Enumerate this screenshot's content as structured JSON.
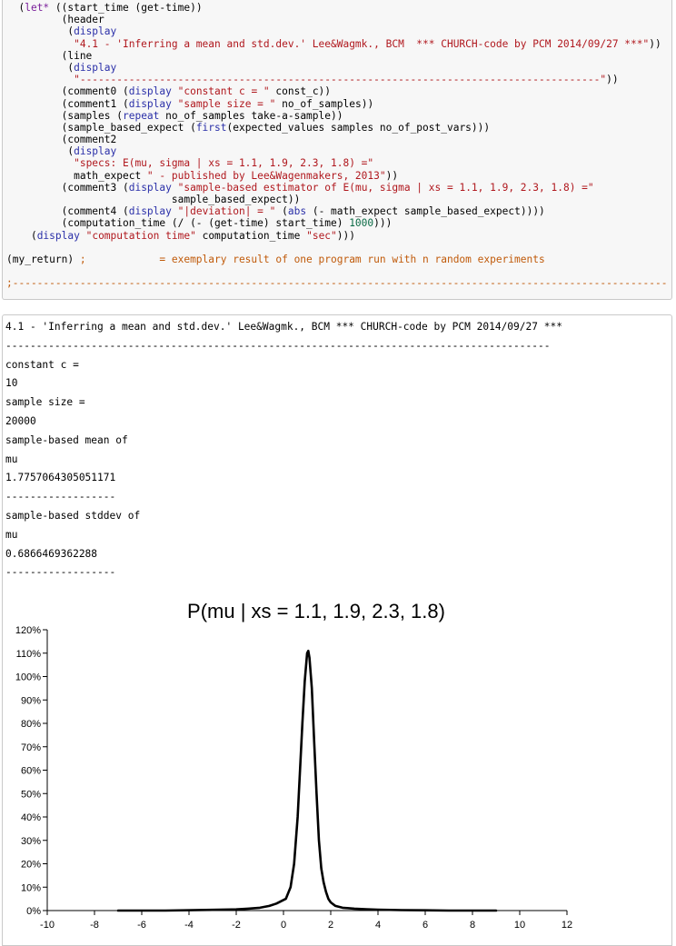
{
  "code": {
    "lines": [
      [
        [
          "",
          "  ("
        ],
        [
          "kw",
          "let*"
        ],
        [
          "",
          " ((start_time (get-time))"
        ]
      ],
      [
        [
          "",
          "         (header"
        ]
      ],
      [
        [
          "",
          "          ("
        ],
        [
          "fn",
          "display"
        ]
      ],
      [
        [
          "",
          "           "
        ],
        [
          "str",
          "\"4.1 - 'Inferring a mean and std.dev.' Lee&Wagmk., BCM  *** CHURCH-code by PCM 2014/09/27 ***\""
        ],
        [
          "",
          "))"
        ]
      ],
      [
        [
          "",
          "         (line"
        ]
      ],
      [
        [
          "",
          "          ("
        ],
        [
          "fn",
          "display"
        ]
      ],
      [
        [
          "",
          "           "
        ],
        [
          "str",
          "\"-------------------------------------------------------------------------------------\""
        ],
        [
          "",
          "))"
        ]
      ],
      [
        [
          "",
          "         (comment0 ("
        ],
        [
          "fn",
          "display"
        ],
        [
          "",
          " "
        ],
        [
          "str",
          "\"constant c = \""
        ],
        [
          "",
          " const_c))"
        ]
      ],
      [
        [
          "",
          "         (comment1 ("
        ],
        [
          "fn",
          "display"
        ],
        [
          "",
          " "
        ],
        [
          "str",
          "\"sample size = \""
        ],
        [
          "",
          " no_of_samples))"
        ]
      ],
      [
        [
          "",
          "         (samples ("
        ],
        [
          "fn",
          "repeat"
        ],
        [
          "",
          " no_of_samples take-a-sample))"
        ]
      ],
      [
        [
          "",
          "         (sample_based_expect ("
        ],
        [
          "fn",
          "first"
        ],
        [
          "",
          "(expected_values samples no_of_post_vars)))"
        ]
      ],
      [
        [
          "",
          "         (comment2"
        ]
      ],
      [
        [
          "",
          "          ("
        ],
        [
          "fn",
          "display"
        ]
      ],
      [
        [
          "",
          "           "
        ],
        [
          "str",
          "\"specs: E(mu, sigma | xs = 1.1, 1.9, 2.3, 1.8) =\""
        ]
      ],
      [
        [
          "",
          "           math_expect "
        ],
        [
          "str",
          "\" - published by Lee&Wagenmakers, 2013\""
        ],
        [
          "",
          "))"
        ]
      ],
      [
        [
          "",
          "         (comment3 ("
        ],
        [
          "fn",
          "display"
        ],
        [
          "",
          " "
        ],
        [
          "str",
          "\"sample-based estimator of E(mu, sigma | xs = 1.1, 1.9, 2.3, 1.8) =\""
        ]
      ],
      [
        [
          "",
          "                           sample_based_expect))"
        ]
      ],
      [
        [
          "",
          "         (comment4 ("
        ],
        [
          "fn",
          "display"
        ],
        [
          "",
          " "
        ],
        [
          "str",
          "\"|deviation| = \""
        ],
        [
          "",
          " ("
        ],
        [
          "fn",
          "abs"
        ],
        [
          "",
          " (- math_expect sample_based_expect))))"
        ]
      ],
      [
        [
          "",
          "         (computation_time (/ (- (get-time) start_time) "
        ],
        [
          "num",
          "1000"
        ],
        [
          "",
          ")))"
        ]
      ],
      [
        [
          "",
          "    ("
        ],
        [
          "fn",
          "display"
        ],
        [
          "",
          " "
        ],
        [
          "str",
          "\"computation time\""
        ],
        [
          "",
          " computation_time "
        ],
        [
          "str",
          "\"sec\""
        ],
        [
          "",
          ")))"
        ]
      ],
      [
        [
          "",
          ""
        ]
      ],
      [
        [
          "",
          "(my_return) "
        ],
        [
          "cmt",
          ";            = exemplary result of one program run with n random experiments"
        ]
      ],
      [
        [
          "",
          ""
        ]
      ],
      [
        [
          "cmt",
          ";-----------------------------------------------------------------------------------------------------------"
        ]
      ]
    ]
  },
  "output": {
    "lines": [
      "4.1 - 'Inferring a mean and std.dev.' Lee&Wagmk., BCM *** CHURCH-code by PCM 2014/09/27 ***",
      "-----------------------------------------------------------------------------------------",
      "constant c =",
      "10",
      "sample size =",
      "20000",
      "sample-based mean of",
      "mu",
      "1.7757064305051171",
      "------------------",
      "sample-based stddev of",
      "mu",
      "0.6866469362288",
      "------------------"
    ]
  },
  "chart_data": {
    "type": "line",
    "title": "P(mu | xs = 1.1, 1.9, 2.3, 1.8)",
    "xlabel": "",
    "ylabel": "",
    "xlim": [
      -10,
      12
    ],
    "ylim": [
      0,
      1.2
    ],
    "x_ticks": [
      -10,
      -8,
      -6,
      -4,
      -2,
      0,
      2,
      4,
      6,
      8,
      10,
      12
    ],
    "y_ticks": [
      0,
      0.1,
      0.2,
      0.3,
      0.4,
      0.5,
      0.6,
      0.7,
      0.8,
      0.9,
      1.0,
      1.1,
      1.2
    ],
    "y_tick_labels": [
      "0%",
      "10%",
      "20%",
      "30%",
      "40%",
      "50%",
      "60%",
      "70%",
      "80%",
      "90%",
      "100%",
      "110%",
      "120%"
    ],
    "grid": false,
    "line_color": "#000000",
    "series": [
      {
        "x": [
          -7.0,
          -5.0,
          -3.0,
          -2.0,
          -1.5,
          -1.0,
          -0.6,
          -0.3,
          -0.1,
          0.1,
          0.3,
          0.45,
          0.6,
          0.7,
          0.8,
          0.9,
          1.0,
          1.05,
          1.1,
          1.2,
          1.3,
          1.4,
          1.5,
          1.6,
          1.7,
          1.8,
          1.9,
          2.0,
          2.2,
          2.5,
          3.0,
          3.5,
          4.0,
          5.0,
          6.0,
          7.0,
          8.0,
          9.0
        ],
        "y": [
          0.0,
          0.0,
          0.003,
          0.005,
          0.008,
          0.012,
          0.02,
          0.03,
          0.04,
          0.05,
          0.1,
          0.2,
          0.4,
          0.6,
          0.8,
          0.98,
          1.1,
          1.11,
          1.08,
          0.95,
          0.72,
          0.5,
          0.3,
          0.18,
          0.12,
          0.08,
          0.05,
          0.035,
          0.02,
          0.012,
          0.008,
          0.006,
          0.004,
          0.002,
          0.001,
          0.0,
          0.0,
          0.0
        ]
      }
    ]
  }
}
